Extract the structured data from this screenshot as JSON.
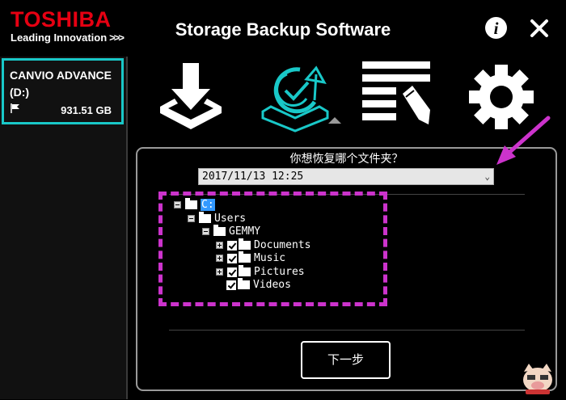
{
  "header": {
    "brand_name": "TOSHIBA",
    "brand_tagline": "Leading Innovation",
    "brand_chevrons": ">>>",
    "app_title": "Storage Backup Software",
    "info_icon": "i"
  },
  "colors": {
    "brand_red": "#e60012",
    "accent_cyan": "#19c8c8",
    "annotation_magenta": "#cc33cc"
  },
  "sidebar": {
    "drive": {
      "name": "CANVIO ADVANCE",
      "letter": "(D:)",
      "capacity": "931.51 GB"
    }
  },
  "toolbar": {
    "items": [
      {
        "name": "backup",
        "icon": "download-tray-icon"
      },
      {
        "name": "restore",
        "icon": "restore-cycle-icon",
        "selected": true
      },
      {
        "name": "edit",
        "icon": "list-edit-icon"
      },
      {
        "name": "settings",
        "icon": "gear-icon"
      }
    ]
  },
  "restore": {
    "prompt": "你想恢复哪个文件夹？",
    "selected_date": "2017/11/13 12:25",
    "tree": {
      "root": "C:",
      "users": "Users",
      "user": "GEMMY",
      "children": [
        "Documents",
        "Music",
        "Pictures",
        "Videos"
      ]
    },
    "next_label": "下一步"
  }
}
